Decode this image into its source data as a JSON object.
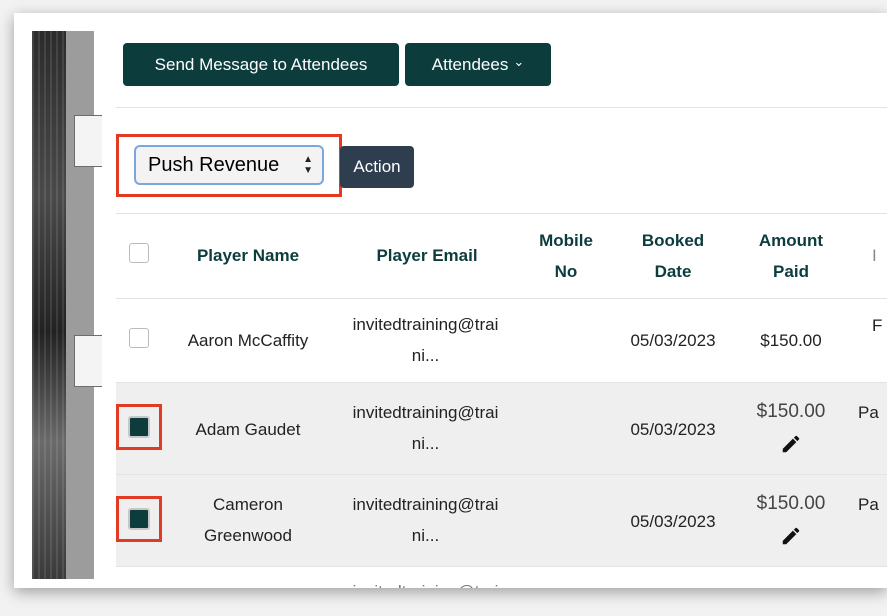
{
  "toolbar": {
    "send_message_label": "Send Message to Attendees",
    "attendees_label": "Attendees",
    "attendees_chevron": "⌄"
  },
  "bulk": {
    "select_value": "Push Revenue",
    "action_label": "Action"
  },
  "table": {
    "headers": {
      "player_name": "Player Name",
      "player_email": "Player Email",
      "mobile_l1": "Mobile",
      "mobile_l2": "No",
      "booked_l1": "Booked",
      "booked_l2": "Date",
      "amount_l1": "Amount",
      "amount_l2": "Paid",
      "next_col": "I"
    },
    "rows": [
      {
        "name_l1": "Aaron McCaffity",
        "email_l1": "invitedtraining@trai",
        "email_l2": "ni...",
        "booked": "05/03/2023",
        "amount": "$150.00",
        "next": "F",
        "checked": false
      },
      {
        "name_l1": "Adam Gaudet",
        "email_l1": "invitedtraining@trai",
        "email_l2": "ni...",
        "booked": "05/03/2023",
        "amount": "$150.00",
        "next": "Pa",
        "checked": true
      },
      {
        "name_l1": "Cameron",
        "name_l2": "Greenwood",
        "email_l1": "invitedtraining@trai",
        "email_l2": "ni...",
        "booked": "05/03/2023",
        "amount": "$150.00",
        "next": "Pa",
        "checked": true
      },
      {
        "email_l1": "invitedtraining@trai"
      }
    ]
  },
  "colors": {
    "brand_dark": "#0d3c3d",
    "action_bg": "#2e3e4f",
    "highlight_red": "#e23b25"
  }
}
